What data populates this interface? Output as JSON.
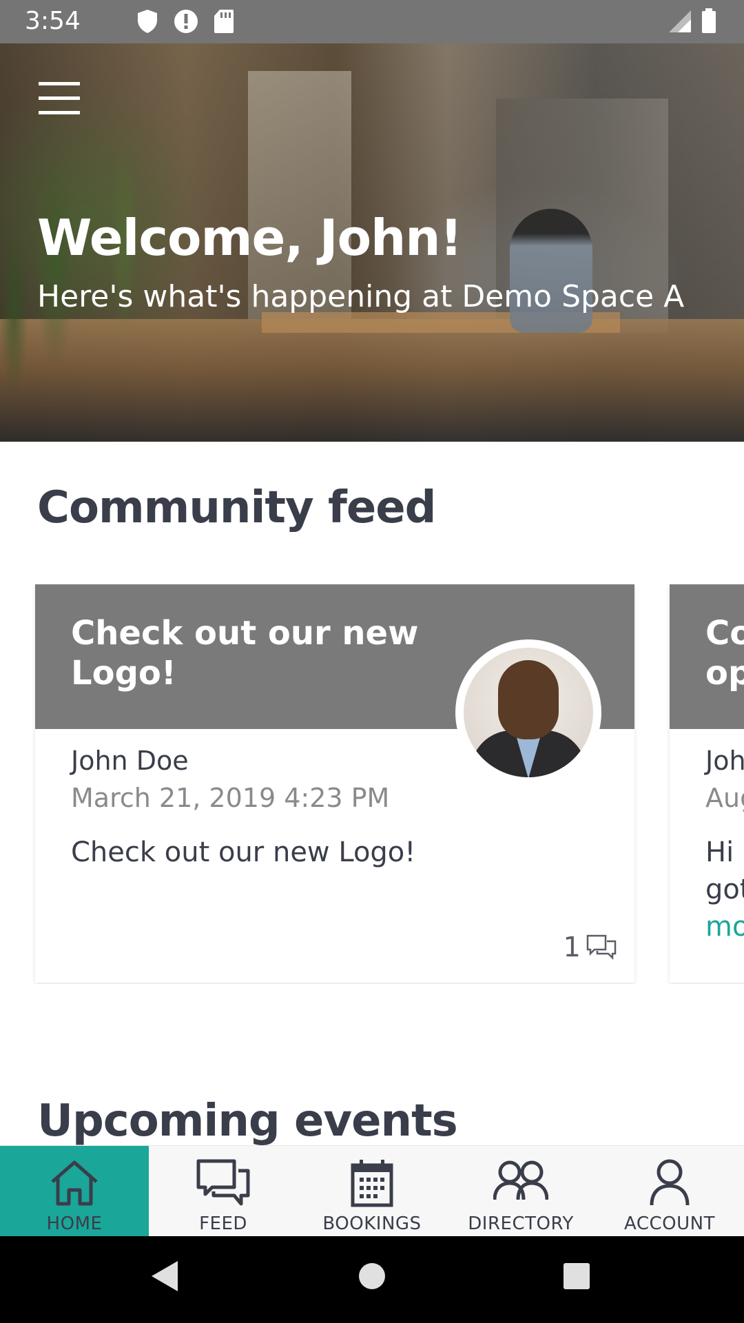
{
  "status_bar": {
    "time": "3:54",
    "left_icons": [
      "shield-icon",
      "alert-icon",
      "sd-card-icon"
    ],
    "right_icons": [
      "signal-icon",
      "battery-icon"
    ]
  },
  "hero": {
    "title": "Welcome, John!",
    "subtitle": "Here's what's happening at Demo Space A"
  },
  "community_feed": {
    "heading": "Community feed",
    "cards": [
      {
        "title": "Check out our new Logo!",
        "author": "John Doe",
        "date": "March 21, 2019 4:23 PM",
        "body": "Check out our new Logo!",
        "more": "",
        "comment_count": "1"
      },
      {
        "title": "Co op",
        "author": "Joh",
        "date": "Aug",
        "body": "Hi got",
        "more": "mo",
        "comment_count": ""
      }
    ]
  },
  "upcoming_events": {
    "heading": "Upcoming events"
  },
  "bottom_nav": {
    "items": [
      {
        "label": "HOME",
        "icon": "home-icon",
        "active": true
      },
      {
        "label": "FEED",
        "icon": "chat-icon",
        "active": false
      },
      {
        "label": "BOOKINGS",
        "icon": "calendar-icon",
        "active": false
      },
      {
        "label": "DIRECTORY",
        "icon": "people-icon",
        "active": false
      },
      {
        "label": "ACCOUNT",
        "icon": "person-icon",
        "active": false
      }
    ]
  },
  "colors": {
    "accent": "#1aa699",
    "text_dark": "#3a3d4a",
    "card_header": "#7a7a7a",
    "status_bar": "#757575"
  }
}
